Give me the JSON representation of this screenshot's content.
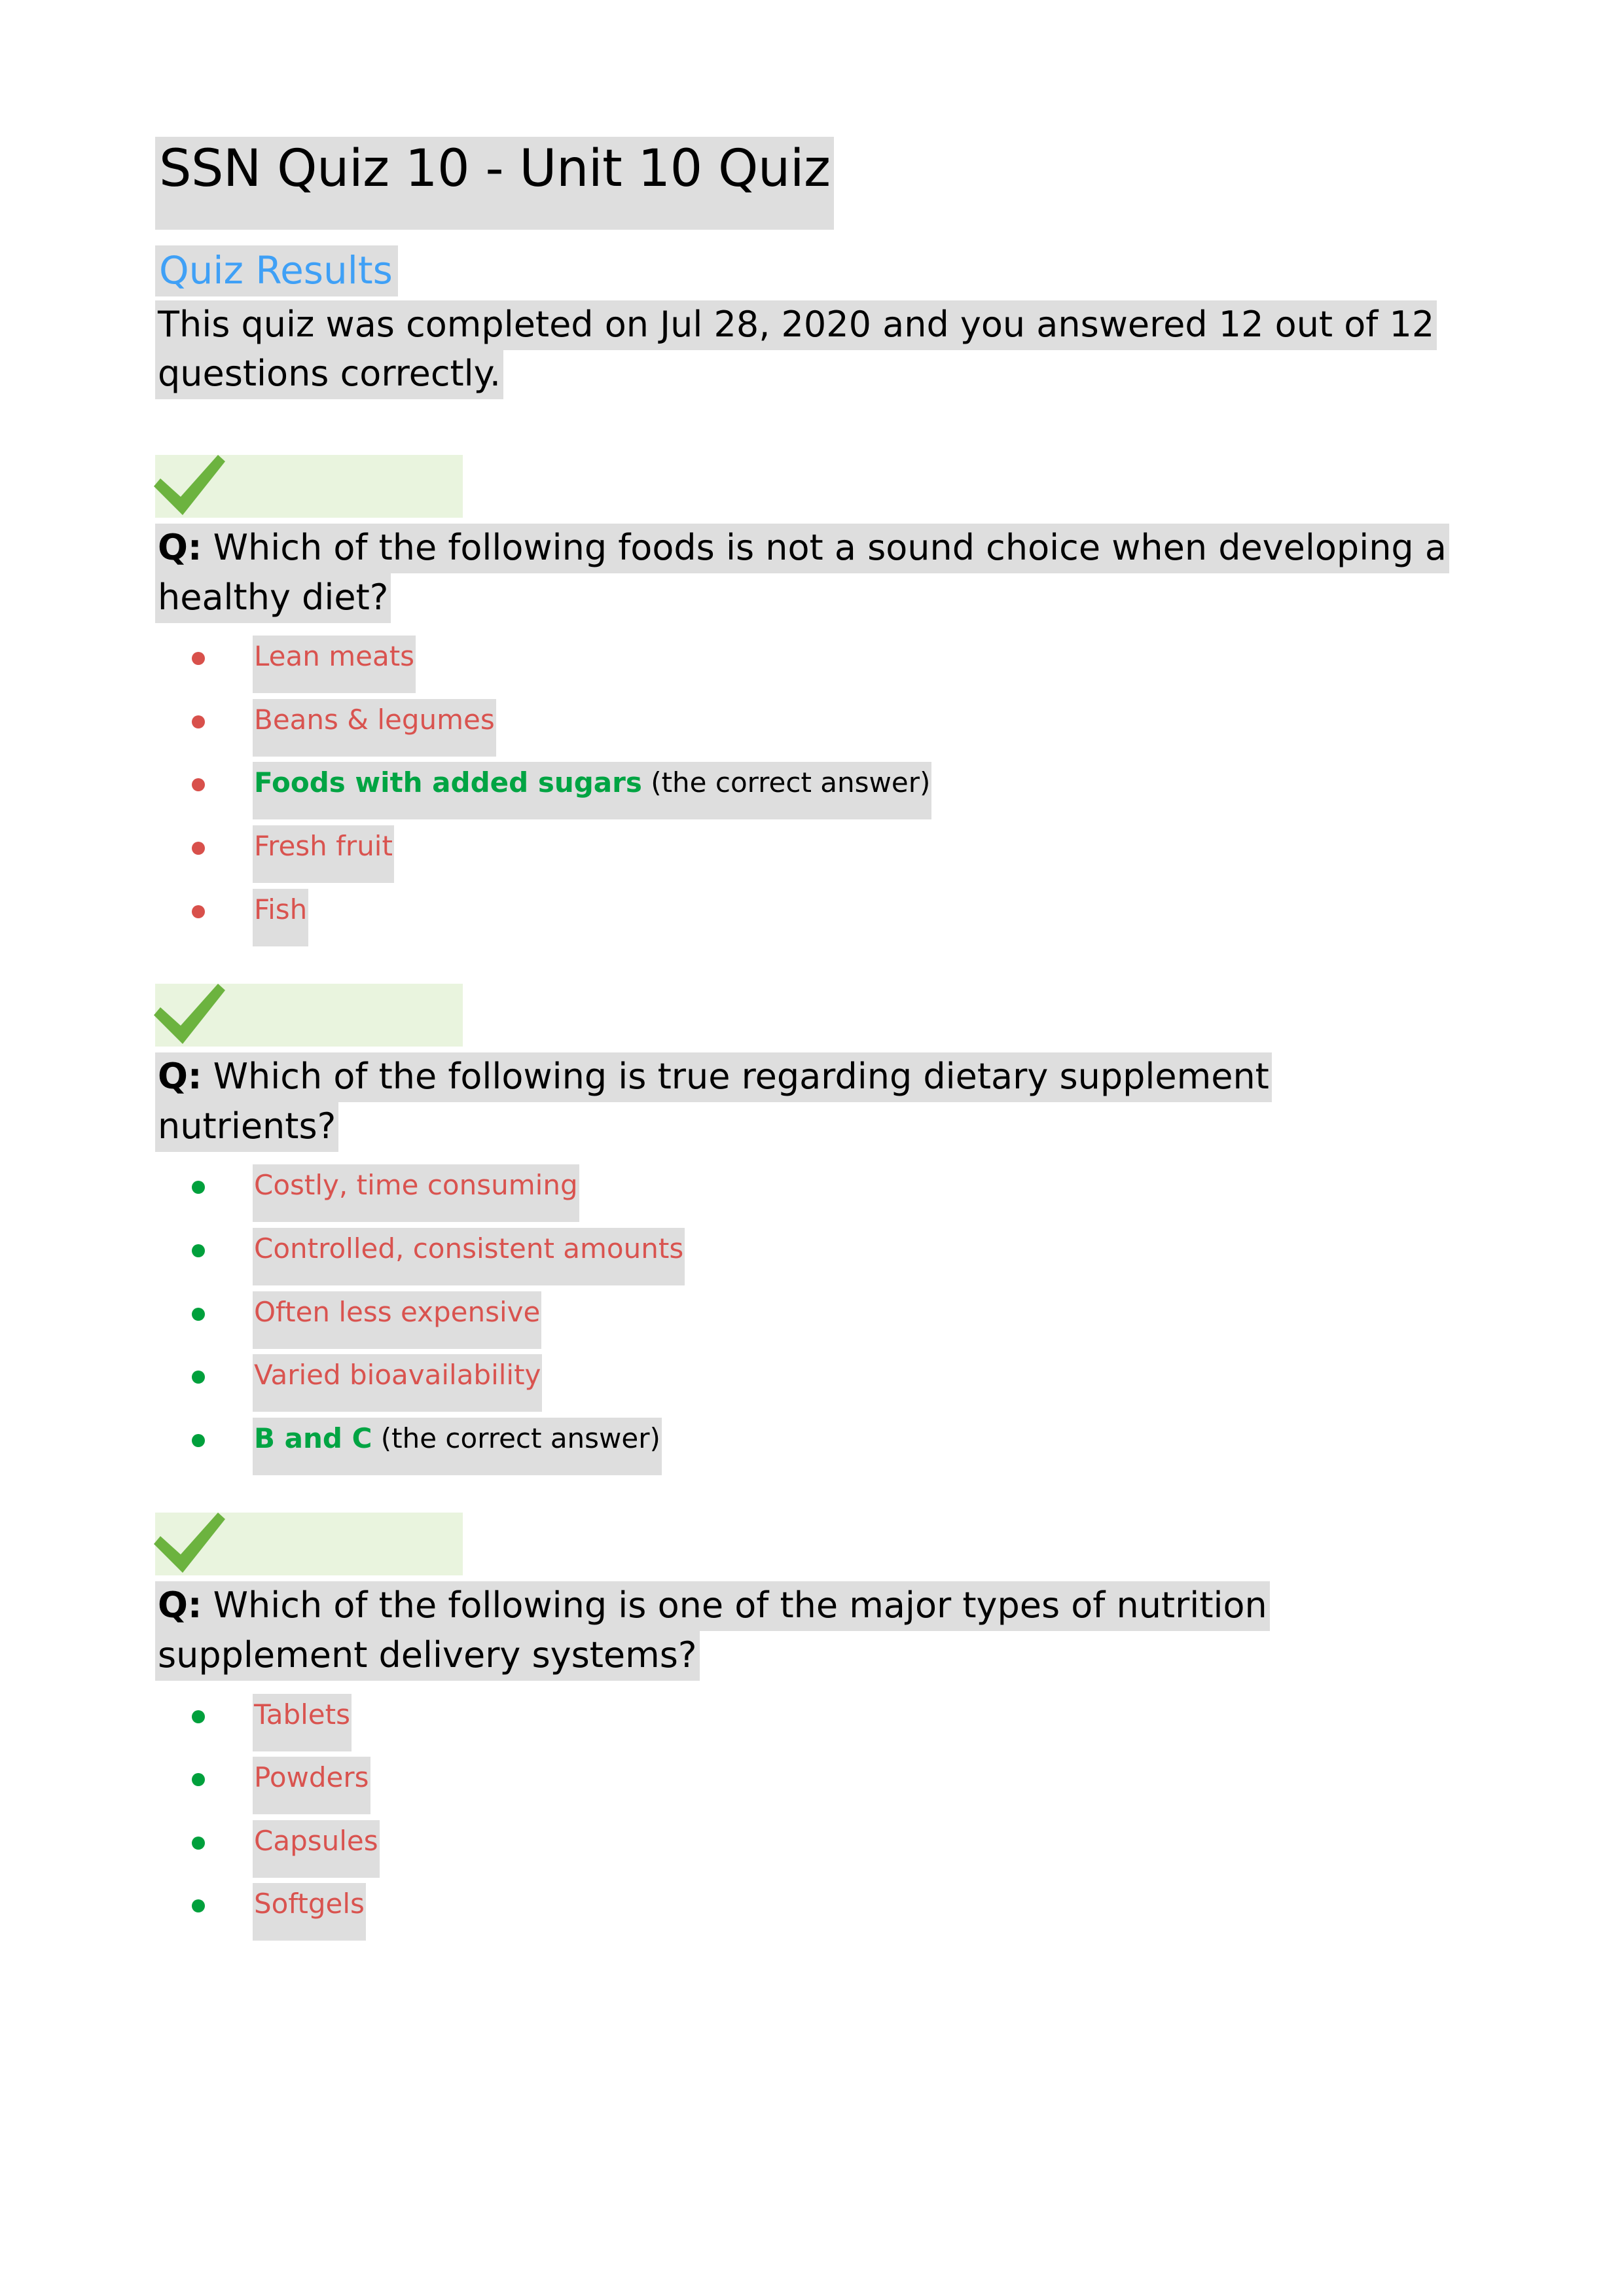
{
  "document": {
    "title": "SSN Quiz 10 - Unit 10 Quiz",
    "section_heading": "Quiz Results",
    "summary": "This quiz was completed on Jul 28, 2020 and you answered 12 out of 12 questions correctly.",
    "question_label": "Q:",
    "correct_answer_note": "(the correct answer)"
  },
  "colors": {
    "heading_blue": "#3fa0f6",
    "answer_red": "#d9534f",
    "correct_green": "#00a443",
    "bullet_green": "#00a03c",
    "bullet_red": "#d8504b",
    "text_highlight_gray": "#dedede",
    "check_highlight_green": "#e9f4de",
    "check_mark_green": "#6cb33f"
  },
  "questions": [
    {
      "status_icon": "green-check-icon",
      "text": "Which of the following foods is not a sound choice when developing a healthy diet?",
      "bullet_color": "red",
      "answers": [
        {
          "text": "Lean meats",
          "correct": false
        },
        {
          "text": "Beans & legumes",
          "correct": false
        },
        {
          "text": "Foods with added sugars",
          "correct": true
        },
        {
          "text": "Fresh fruit",
          "correct": false
        },
        {
          "text": "Fish",
          "correct": false
        }
      ]
    },
    {
      "status_icon": "green-check-icon",
      "text": "Which of the following is true regarding dietary supplement nutrients?",
      "bullet_color": "green",
      "answers": [
        {
          "text": "Costly, time consuming",
          "correct": false
        },
        {
          "text": "Controlled, consistent amounts",
          "correct": false
        },
        {
          "text": "Often less expensive",
          "correct": false
        },
        {
          "text": "Varied bioavailability",
          "correct": false
        },
        {
          "text": "B and C",
          "correct": true
        }
      ]
    },
    {
      "status_icon": "green-check-icon",
      "text": "Which of the following is one of the major types of nutrition supplement delivery systems?",
      "bullet_color": "green",
      "answers": [
        {
          "text": "Tablets",
          "correct": false
        },
        {
          "text": "Powders",
          "correct": false
        },
        {
          "text": "Capsules",
          "correct": false
        },
        {
          "text": "Softgels",
          "correct": false
        }
      ]
    }
  ]
}
